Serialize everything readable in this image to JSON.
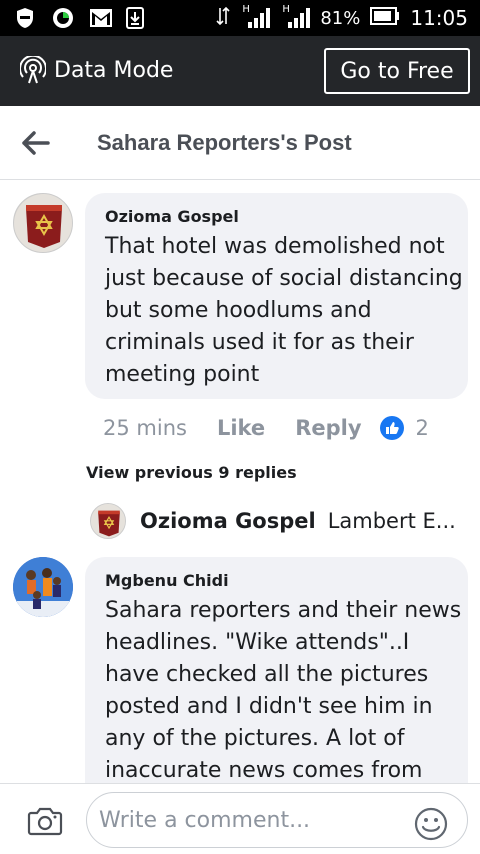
{
  "status_bar": {
    "signal_h_label": "H",
    "battery": "81%",
    "time": "11:05"
  },
  "data_mode_bar": {
    "label": "Data Mode",
    "go_free_label": "Go to Free"
  },
  "header": {
    "title": "Sahara Reporters's Post"
  },
  "comments": [
    {
      "author": "Ozioma Gospel",
      "text": "That hotel was demolished not just because of social distancing but some hoodlums and criminals used it for as their meeting point",
      "time": "25 mins",
      "like_label": "Like",
      "reply_label": "Reply",
      "reaction_count": "2"
    },
    {
      "author": "Mgbenu Chidi",
      "text": "Sahara reporters and their news headlines. \"Wike attends\"..I have checked all the pictures posted and I didn't see him in any of the pictures. A lot of inaccurate news comes from"
    }
  ],
  "replies": {
    "view_previous": "View previous 9 replies",
    "latest_author": "Ozioma Gospel",
    "latest_text": "Lambert E..."
  },
  "composer": {
    "placeholder": "Write a comment..."
  },
  "colors": {
    "status_bar_bg": "#000000",
    "data_mode_bg": "#242629",
    "bubble_bg": "#f1f2f6",
    "like_blue": "#1877f2",
    "meta_gray": "#8d949e"
  }
}
